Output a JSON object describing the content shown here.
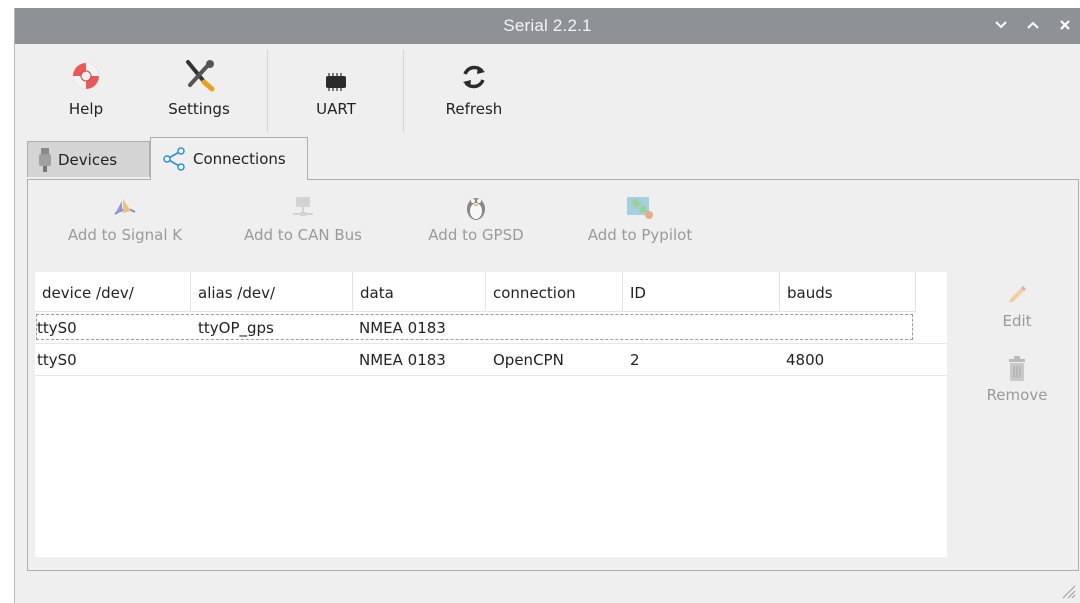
{
  "window": {
    "title": "Serial 2.2.1"
  },
  "toolbar": {
    "buttons": [
      {
        "label": "Help",
        "icon": "lifebuoy-icon"
      },
      {
        "label": "Settings",
        "icon": "wrench-screwdriver-icon"
      },
      {
        "label": "UART",
        "icon": "chip-icon"
      },
      {
        "label": "Refresh",
        "icon": "refresh-icon"
      }
    ]
  },
  "tabs": [
    {
      "label": "Devices",
      "icon": "usb-plug-icon",
      "active": false
    },
    {
      "label": "Connections",
      "icon": "share-icon",
      "active": true
    }
  ],
  "actions": [
    {
      "label": "Add to Signal K",
      "icon": "signalk-icon"
    },
    {
      "label": "Add to CAN Bus",
      "icon": "network-icon"
    },
    {
      "label": "Add to GPSD",
      "icon": "penguin-icon"
    },
    {
      "label": "Add to Pypilot",
      "icon": "map-icon"
    }
  ],
  "table": {
    "columns": [
      "device /dev/",
      "alias /dev/",
      "data",
      "connection",
      "ID",
      "bauds"
    ],
    "rows": [
      [
        "ttyS0",
        "ttyOP_gps",
        "NMEA 0183",
        "",
        "",
        ""
      ],
      [
        "ttyS0",
        "",
        "NMEA 0183",
        "OpenCPN",
        "2",
        "4800"
      ]
    ]
  },
  "side_actions": {
    "edit": "Edit",
    "remove": "Remove"
  },
  "colors": {
    "titlebar": "#8e9196",
    "window_bg": "#efefef",
    "disabled_text": "#9a9a9a"
  }
}
